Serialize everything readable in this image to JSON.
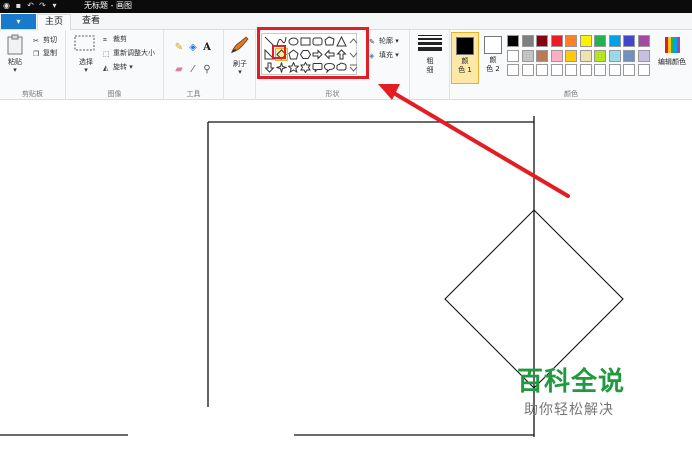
{
  "window": {
    "title": "无标题 - 画图"
  },
  "quick_access": {
    "icons": [
      "paint-app-icon",
      "save-icon",
      "undo-icon",
      "redo-icon",
      "dropdown-icon"
    ]
  },
  "tabs": {
    "file_label": "▾",
    "home_label": "主页",
    "view_label": "查看"
  },
  "clipboard": {
    "paste_label": "粘贴",
    "cut_label": "剪切",
    "copy_label": "复制",
    "group_label": "剪贴板"
  },
  "image": {
    "select_label": "选择",
    "crop_label": "裁剪",
    "resize_label": "重新调整大小",
    "rotate_label": "旋转",
    "group_label": "图像"
  },
  "tools": {
    "group_label": "工具",
    "text_tool": "A"
  },
  "brushes": {
    "label": "刷子"
  },
  "shapes": {
    "outline_label": "轮廓",
    "fill_label": "填充",
    "group_label": "形状",
    "selected": "diamond"
  },
  "size": {
    "label_line1": "粗",
    "label_line2": "细"
  },
  "colors": {
    "color1_line1": "颜",
    "color1_line2": "色 1",
    "color2_line1": "颜",
    "color2_line2": "色 2",
    "edit_label": "编辑颜色",
    "group_label": "颜色",
    "color1_value": "#000000",
    "color2_value": "#ffffff",
    "palette_row1": [
      "#000000",
      "#7f7f7f",
      "#880015",
      "#ed1c24",
      "#ff7f27",
      "#fff200",
      "#22b14c",
      "#00a2e8",
      "#3f48cc",
      "#a349a4"
    ],
    "palette_row2": [
      "#ffffff",
      "#c3c3c3",
      "#b97a57",
      "#ffaec9",
      "#ffc90e",
      "#efe4b0",
      "#b5e61d",
      "#99d9ea",
      "#7092be",
      "#c8bfe7"
    ],
    "palette_row3": [
      "#ffffff",
      "#ffffff",
      "#ffffff",
      "#ffffff",
      "#ffffff",
      "#ffffff",
      "#ffffff",
      "#ffffff",
      "#ffffff",
      "#ffffff"
    ],
    "accent_highlight": "#e21d23"
  },
  "watermark": {
    "title": "百科全说",
    "subtitle": "助你轻松解决",
    "color": "#1f9a3e"
  }
}
